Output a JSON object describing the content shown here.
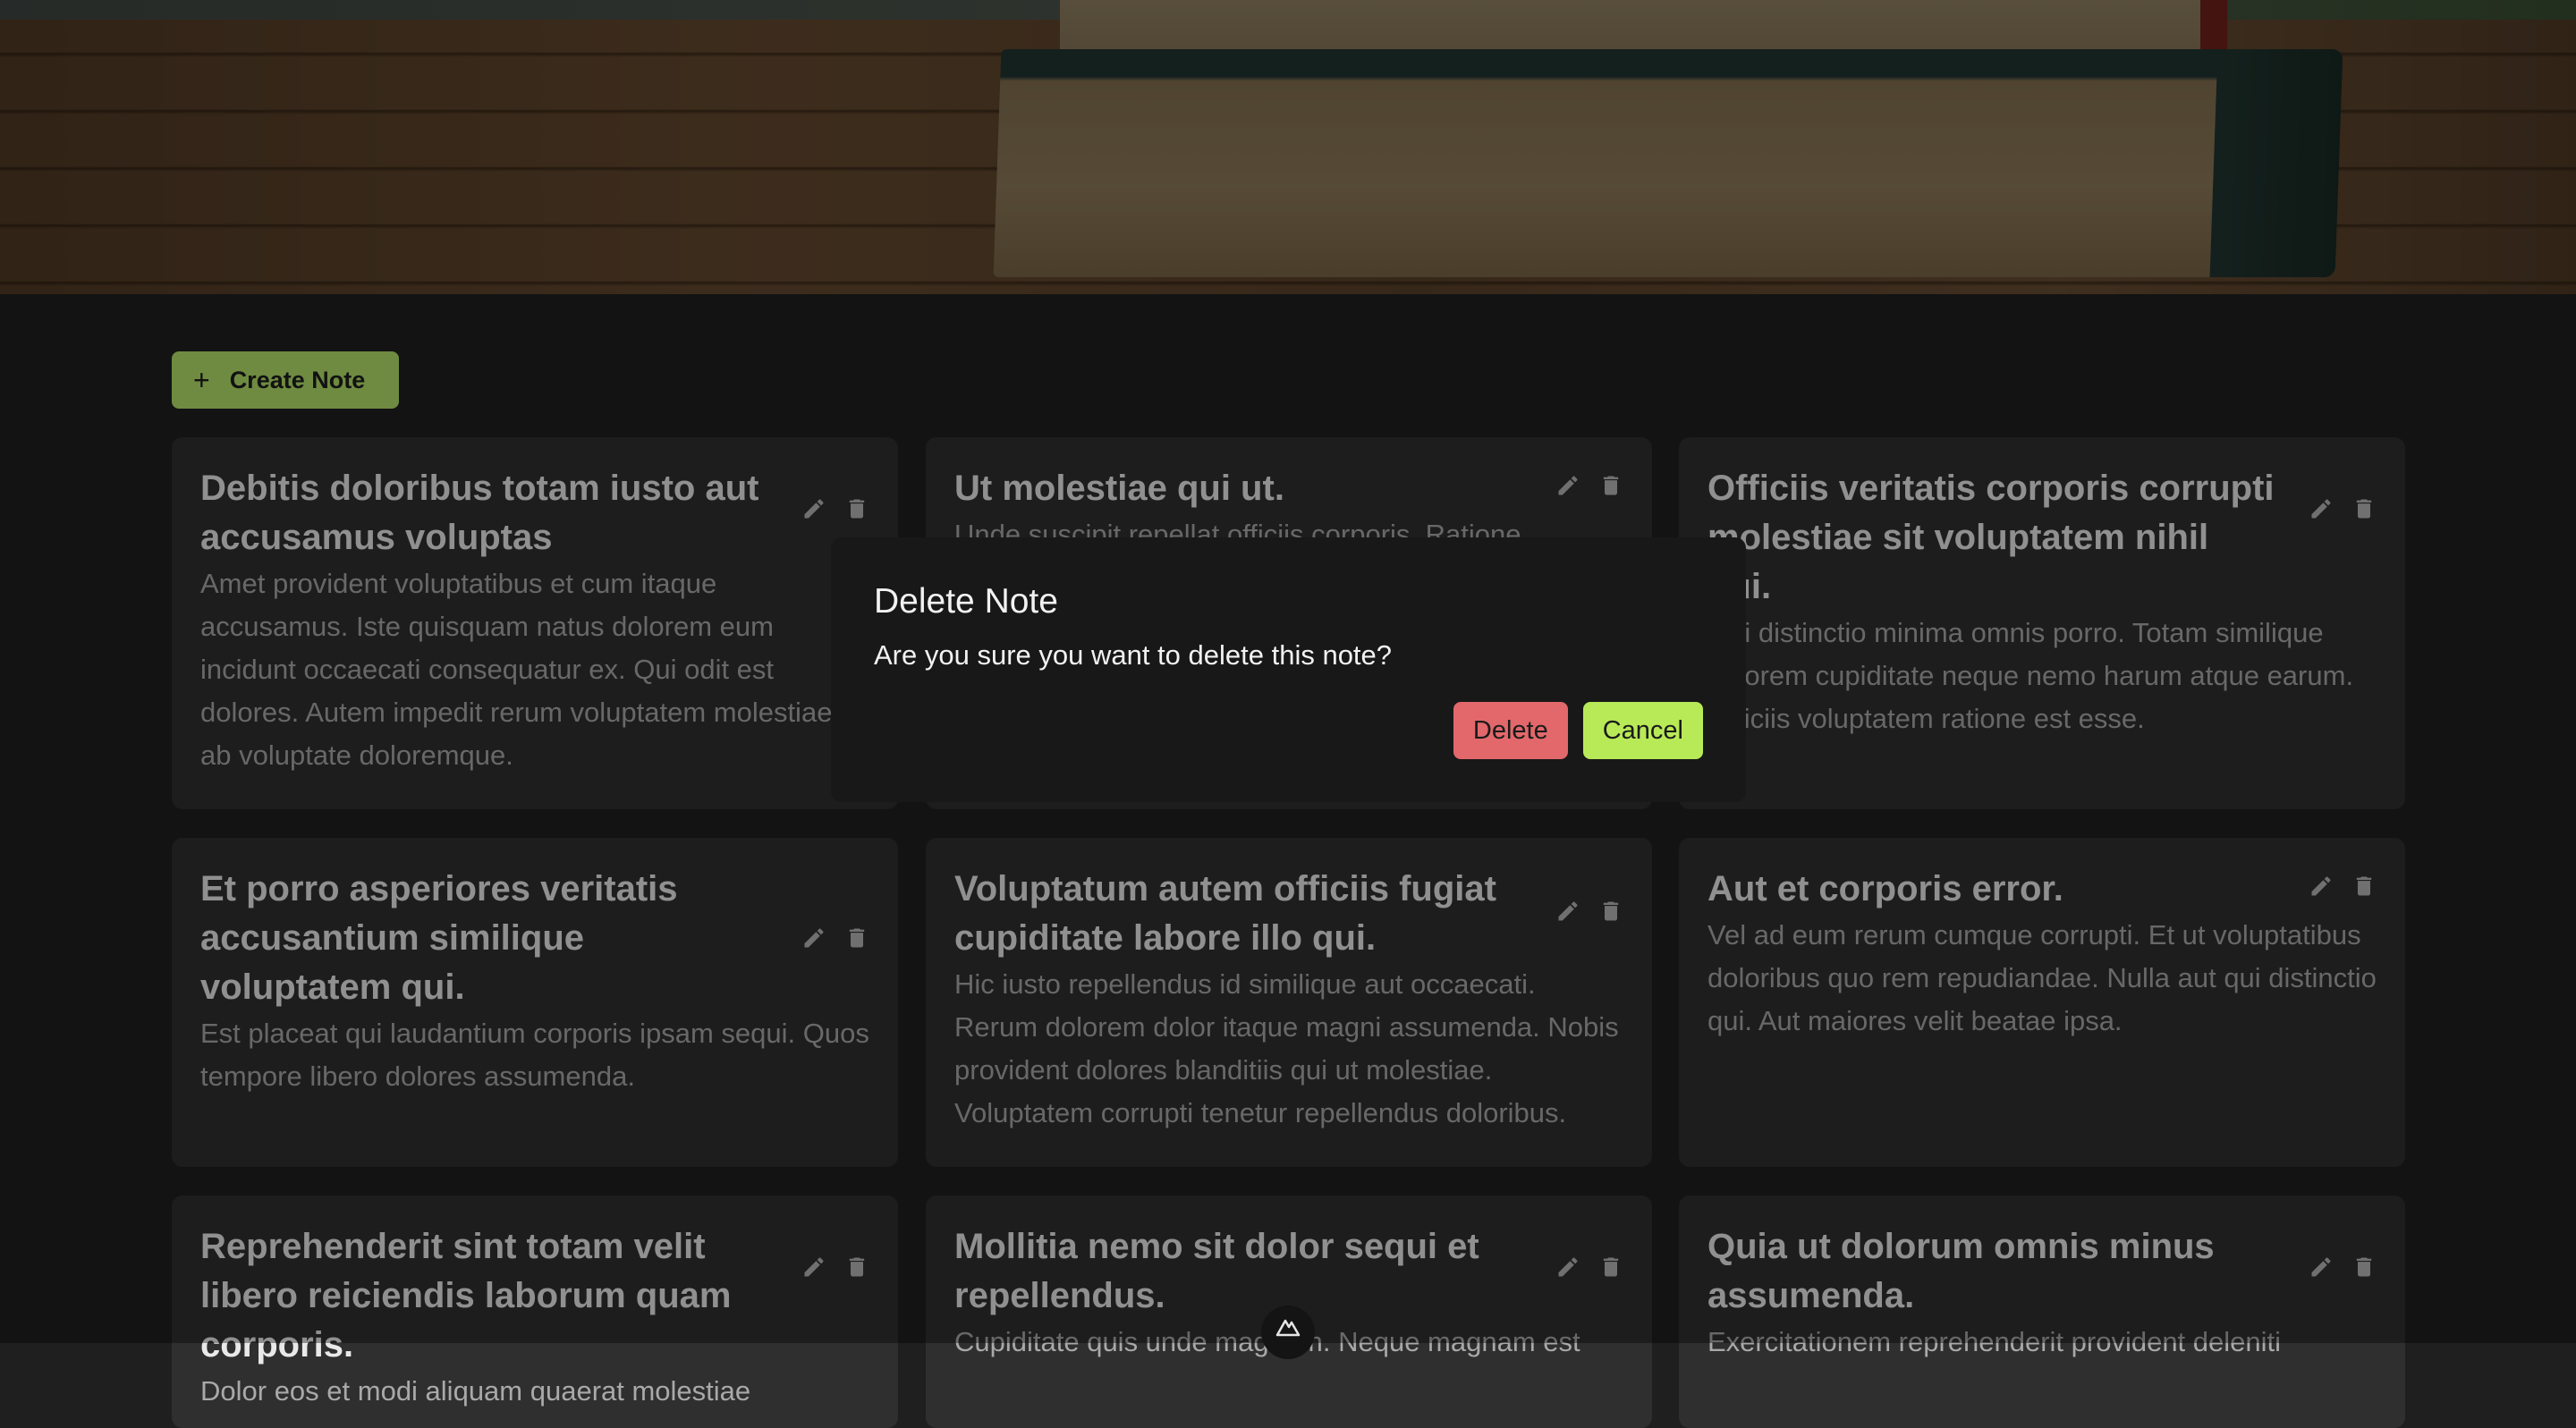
{
  "toolbar": {
    "create_label": "Create Note",
    "create_icon": "plus-icon"
  },
  "notes": [
    {
      "title": "Debitis doloribus totam iusto aut accusamus voluptas",
      "body": "Amet provident voluptatibus et cum itaque accusamus. Iste quisquam natus dolorem eum incidunt occaecati consequatur ex. Qui odit est dolores. Autem impedit rerum voluptatem molestiae ab voluptate doloremque."
    },
    {
      "title": "Ut molestiae qui ut.",
      "body": "Unde suscipit repellat officiis corporis. Ratione"
    },
    {
      "title": "Officiis veritatis corporis corrupti molestiae sit voluptatem nihil qui.",
      "body": "Qui distinctio minima omnis porro. Totam similique dolorem cupiditate neque nemo harum atque earum. Officiis voluptatem ratione est esse."
    },
    {
      "title": "Et porro asperiores veritatis accusantium similique voluptatem qui.",
      "body": "Est placeat qui laudantium corporis ipsam sequi. Quos tempore libero dolores assumenda."
    },
    {
      "title": "Voluptatum autem officiis fugiat cupiditate labore illo qui.",
      "body": "Hic iusto repellendus id similique aut occaecati. Rerum dolorem dolor itaque magni assumenda. Nobis provident dolores blanditiis qui ut molestiae. Voluptatem corrupti tenetur repellendus doloribus."
    },
    {
      "title": "Aut et corporis error.",
      "body": "Vel ad eum rerum cumque corrupti. Et ut voluptatibus doloribus quo rem repudiandae. Nulla aut qui distinctio qui. Aut maiores velit beatae ipsa."
    },
    {
      "title": "Reprehenderit sint totam velit libero reiciendis laborum quam corporis.",
      "body": "Dolor eos et modi aliquam quaerat molestiae"
    },
    {
      "title": "Mollitia nemo sit dolor sequi et repellendus.",
      "body": "Cupiditate quis unde magnam. Neque magnam est"
    },
    {
      "title": "Quia ut dolorum omnis minus assumenda.",
      "body": "Exercitationem reprehenderit provident deleniti"
    }
  ],
  "modal": {
    "title": "Delete Note",
    "message": "Are you sure you want to delete this note?",
    "delete_label": "Delete",
    "cancel_label": "Cancel"
  },
  "colors": {
    "accent": "#b3e06a",
    "danger": "#e2686b",
    "card": "#2f2f2f",
    "background": "#1f1f1f"
  }
}
